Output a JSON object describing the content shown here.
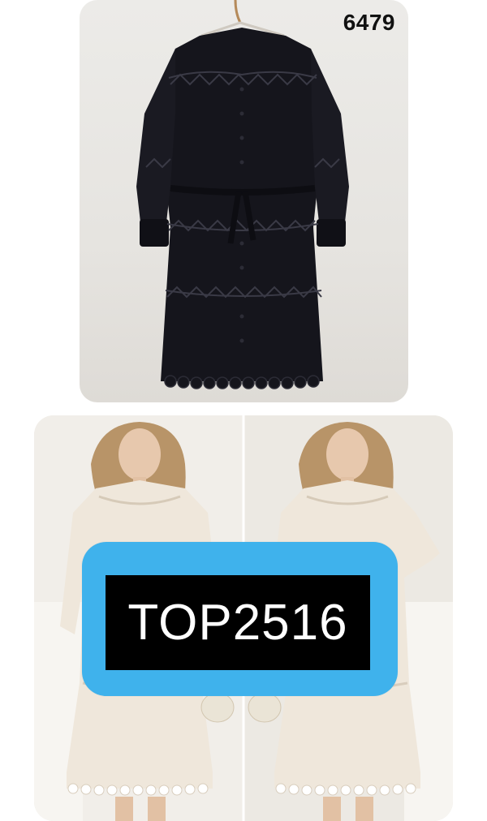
{
  "product_code": "6479",
  "promo_code": "TOP2516",
  "colors": {
    "badge": "#3fb2ec",
    "label_bg": "#000000",
    "label_text": "#ffffff",
    "dress_dark": "#15151c",
    "dress_light": "#efe7db"
  }
}
